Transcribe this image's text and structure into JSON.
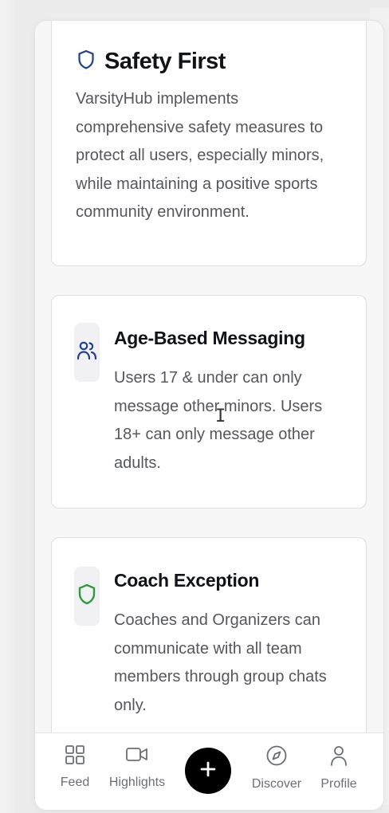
{
  "safety": {
    "title": "Safety First",
    "body": "VarsityHub implements comprehensive safety measures to protect all users, especially minors, while maintaining a positive sports community environment.",
    "icon": "shield-icon"
  },
  "features": [
    {
      "title": "Age-Based Messaging",
      "body": "Users 17 & under can only message other minors. Users 18+ can only message other adults.",
      "icon": "users-icon"
    },
    {
      "title": "Coach Exception",
      "body": "Coaches and Organizers can communicate with all team members through group chats only.",
      "icon": "shield-check-icon"
    }
  ],
  "tabbar": {
    "items": [
      {
        "label": "Feed",
        "icon": "grid-icon"
      },
      {
        "label": "Highlights",
        "icon": "video-icon"
      },
      {
        "label": "",
        "icon": "plus-icon"
      },
      {
        "label": "Discover",
        "icon": "compass-icon"
      },
      {
        "label": "Profile",
        "icon": "user-icon"
      }
    ]
  },
  "colors": {
    "accent_blue": "#1f3f8f",
    "accent_green": "#2e9b3f",
    "title": "#111318",
    "body_text": "#55575c",
    "tab_text": "#6b6e74"
  }
}
